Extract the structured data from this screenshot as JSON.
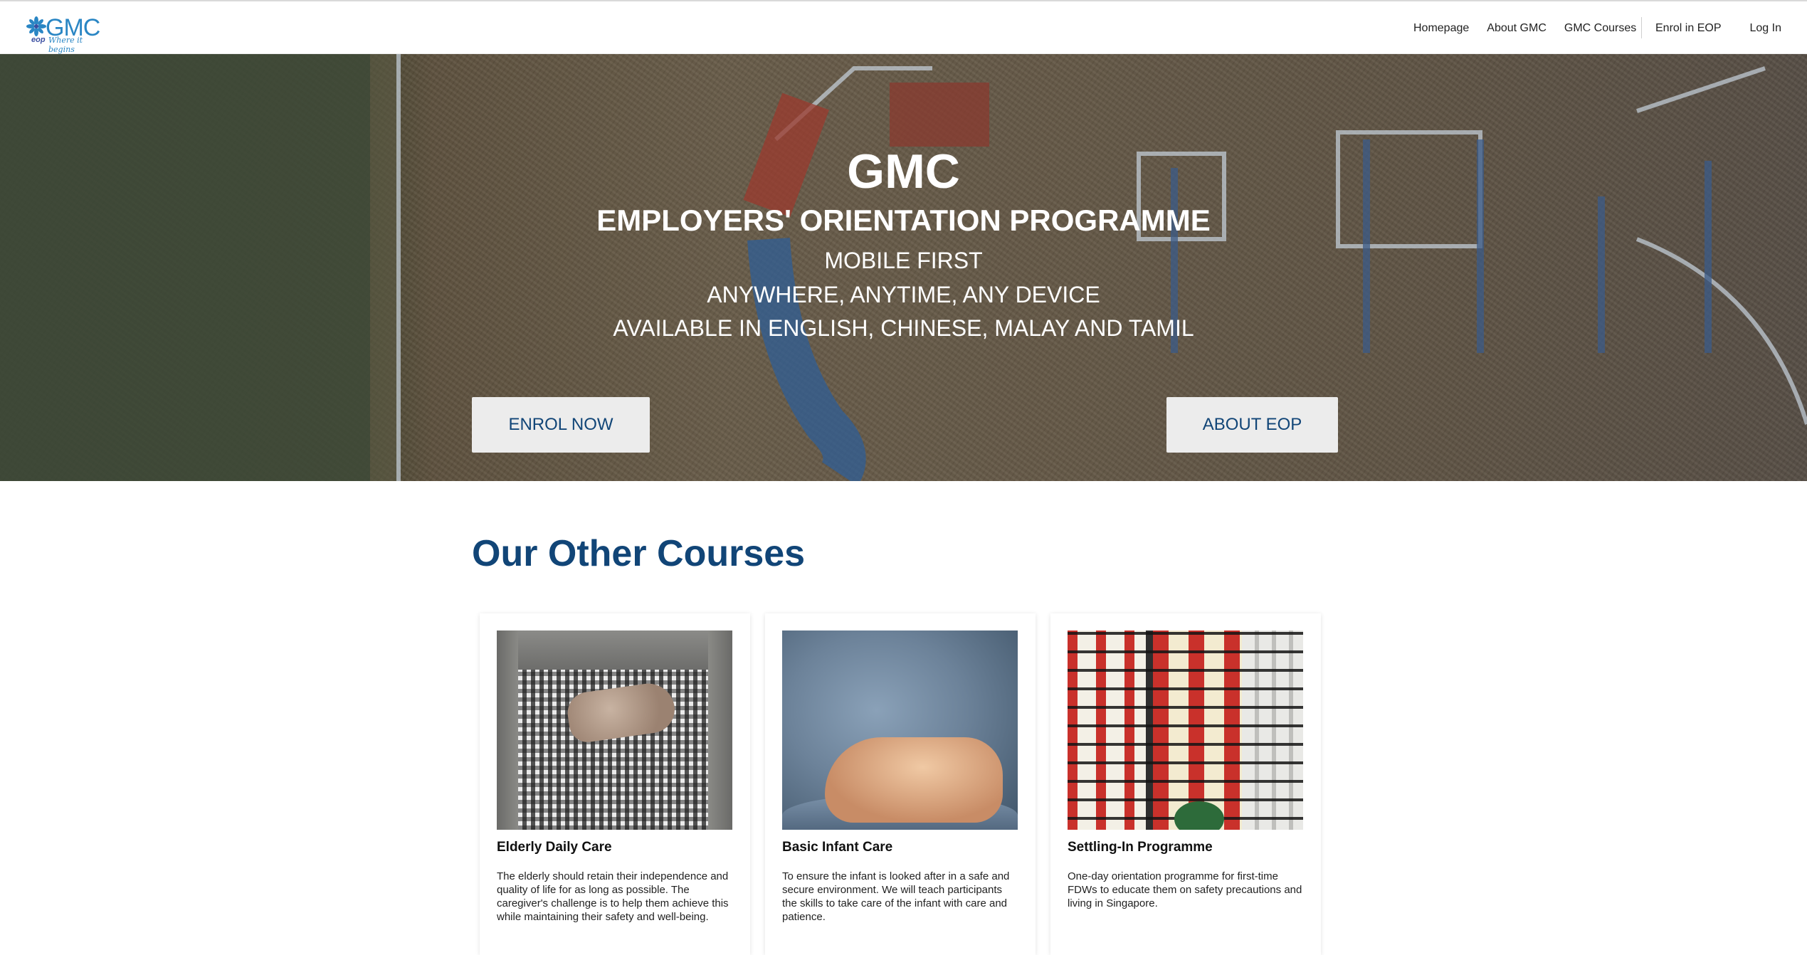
{
  "header": {
    "logo": {
      "text": "GMC",
      "tag_prefix": "eop",
      "tag": "Where it begins"
    },
    "nav_main": [
      "Homepage",
      "About GMC",
      "GMC Courses"
    ],
    "nav_enrol": "Enrol in EOP",
    "nav_login": "Log In"
  },
  "hero": {
    "title": "GMC",
    "subtitle": "EMPLOYERS' ORIENTATION PROGRAMME",
    "line1": "MOBILE FIRST",
    "line2": "ANYWHERE, ANYTIME, ANY DEVICE",
    "line3": "AVAILABLE IN ENGLISH, CHINESE, MALAY AND TAMIL",
    "enrol_button": "ENROL NOW",
    "about_button": "ABOUT EOP"
  },
  "courses": {
    "heading": "Our Other Courses",
    "items": [
      {
        "title": "Elderly Daily Care",
        "description": "The elderly should retain their independence and quality of life for as long as possible. The caregiver's challenge is to help them achieve this while maintaining their safety and well-being."
      },
      {
        "title": "Basic Infant Care",
        "description": "To ensure the infant is looked after in a safe and secure environment. We will teach participants the skills to take care of the infant with care and patience."
      },
      {
        "title": "Settling-In Programme",
        "description": "One-day orientation programme for first-time FDWs to educate them on safety precautions and living in Singapore."
      }
    ]
  },
  "colors": {
    "brand_blue": "#114577",
    "logo_blue": "#2a86c4",
    "button_bg": "#ececec"
  }
}
